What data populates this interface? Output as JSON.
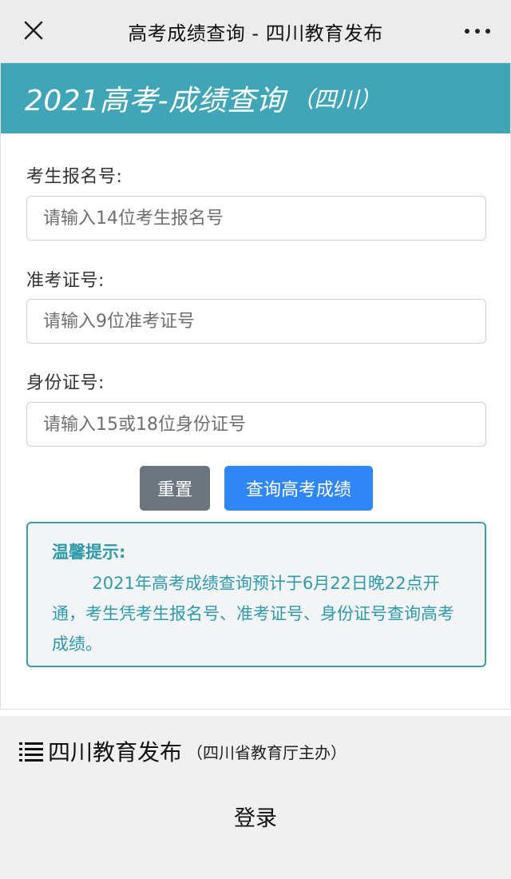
{
  "topbar": {
    "title": "高考成绩查询 - 四川教育发布",
    "close_icon": "close-icon",
    "more_icon": "more-dots-icon"
  },
  "banner": {
    "title": "2021高考-成绩查询",
    "subtitle": "（四川）",
    "color": "#41a5b8"
  },
  "form": {
    "fields": [
      {
        "label": "考生报名号:",
        "placeholder": "请输入14位考生报名号",
        "value": ""
      },
      {
        "label": "准考证号:",
        "placeholder": "请输入9位准考证号",
        "value": ""
      },
      {
        "label": "身份证号:",
        "placeholder": "请输入15或18位身份证号",
        "value": ""
      }
    ],
    "reset_label": "重置",
    "query_label": "查询高考成绩"
  },
  "tip": {
    "title": "温馨提示:",
    "body": "2021年高考成绩查询预计于6月22日晚22点开通，考生凭考生报名号、准考证号、身份证号查询高考成绩。"
  },
  "footer": {
    "org_name": "四川教育发布",
    "org_sub": "（四川省教育厅主办）",
    "login_label": "登录",
    "list_icon": "list-icon"
  },
  "colors": {
    "accent": "#41a5b8",
    "query_button": "#2f86f6",
    "reset_button": "#6c757d",
    "tip_text": "#2f9aa9"
  }
}
